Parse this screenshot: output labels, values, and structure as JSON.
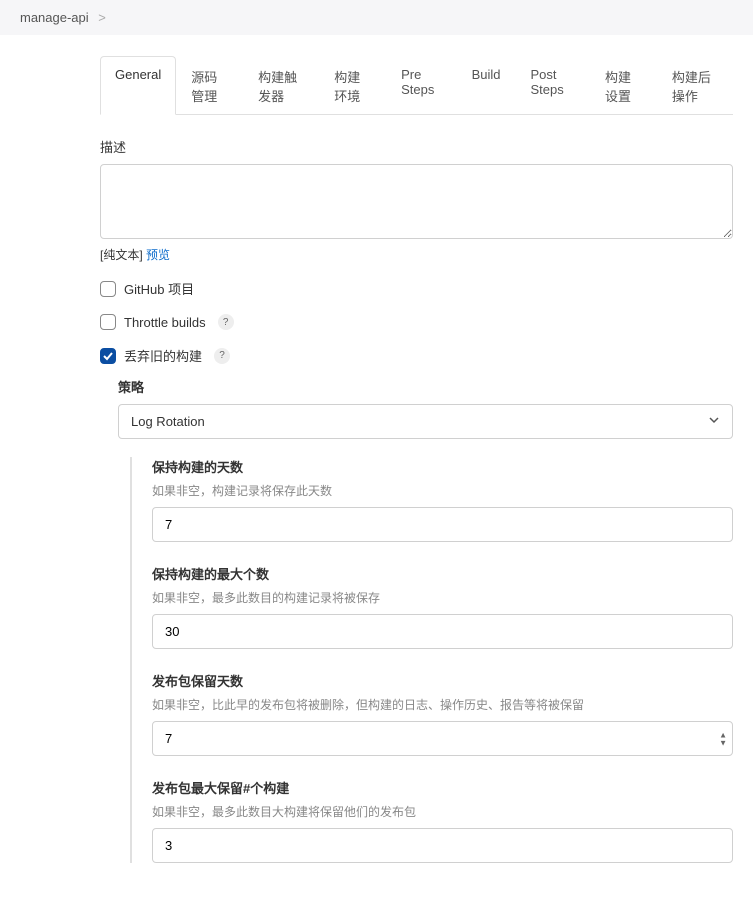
{
  "breadcrumb": {
    "item": "manage-api",
    "separator": ">"
  },
  "tabs": [
    {
      "label": "General",
      "active": true
    },
    {
      "label": "源码管理",
      "active": false
    },
    {
      "label": "构建触发器",
      "active": false
    },
    {
      "label": "构建环境",
      "active": false
    },
    {
      "label": "Pre Steps",
      "active": false
    },
    {
      "label": "Build",
      "active": false
    },
    {
      "label": "Post Steps",
      "active": false
    },
    {
      "label": "构建设置",
      "active": false
    },
    {
      "label": "构建后操作",
      "active": false
    }
  ],
  "description": {
    "label": "描述",
    "value": "",
    "plaintext_prefix": "[纯文本]",
    "preview_link": "预览"
  },
  "checkboxes": {
    "github": {
      "label": "GitHub 项目",
      "checked": false
    },
    "throttle": {
      "label": "Throttle builds",
      "checked": false,
      "help": "?"
    },
    "discard": {
      "label": "丢弃旧的构建",
      "checked": true,
      "help": "?"
    }
  },
  "discard_section": {
    "strategy_label": "策略",
    "strategy_value": "Log Rotation",
    "fields": {
      "days_keep": {
        "title": "保持构建的天数",
        "hint": "如果非空，构建记录将保存此天数",
        "value": "7"
      },
      "max_num": {
        "title": "保持构建的最大个数",
        "hint": "如果非空，最多此数目的构建记录将被保存",
        "value": "30"
      },
      "artifact_days": {
        "title": "发布包保留天数",
        "hint": "如果非空，比此早的发布包将被删除，但构建的日志、操作历史、报告等将被保留",
        "value": "7"
      },
      "artifact_max": {
        "title": "发布包最大保留#个构建",
        "hint": "如果非空，最多此数目大构建将保留他们的发布包",
        "value": "3"
      }
    }
  }
}
